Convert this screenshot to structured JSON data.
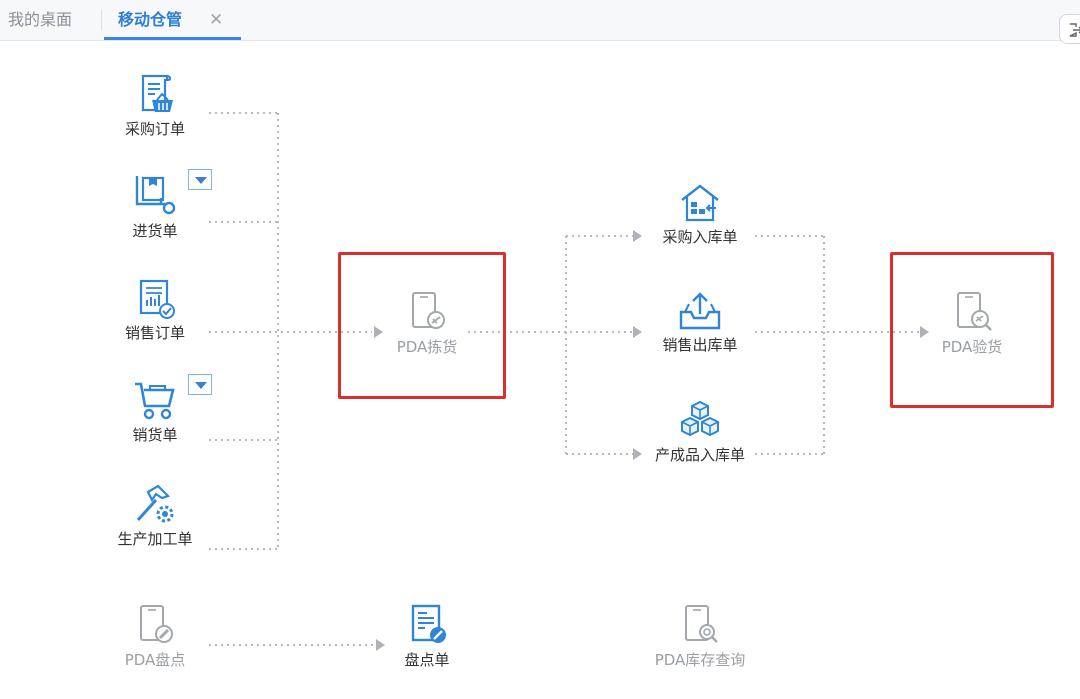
{
  "tabs": {
    "desktop": "我的桌面",
    "active": "移动仓管",
    "close": "✕"
  },
  "flow": {
    "sources": [
      {
        "label": "采购订单",
        "icon": "purchase-order-icon",
        "has_dropdown": false
      },
      {
        "label": "进货单",
        "icon": "receiving-cart-icon",
        "has_dropdown": true
      },
      {
        "label": "销售订单",
        "icon": "sales-order-icon",
        "has_dropdown": false
      },
      {
        "label": "销货单",
        "icon": "shopping-cart-icon",
        "has_dropdown": true
      },
      {
        "label": "生产加工单",
        "icon": "hammer-gear-icon",
        "has_dropdown": false
      }
    ],
    "picking": {
      "label": "PDA拣货",
      "icon": "pda-picking-icon"
    },
    "targets": [
      {
        "label": "采购入库单",
        "icon": "warehouse-in-icon"
      },
      {
        "label": "销售出库单",
        "icon": "tray-out-icon"
      },
      {
        "label": "产成品入库单",
        "icon": "boxes-icon"
      }
    ],
    "inspection": {
      "label": "PDA验货",
      "icon": "pda-inspect-icon"
    }
  },
  "bottom": {
    "stocktake": {
      "label": "PDA盘点",
      "icon": "pda-stocktake-icon"
    },
    "stocktake_sheet": {
      "label": "盘点单",
      "icon": "stocktake-sheet-icon"
    },
    "inventory_query": {
      "label": "PDA库存查询",
      "icon": "pda-search-icon"
    }
  },
  "colors": {
    "accent": "#3a86de",
    "icon_blue": "#2f86d6",
    "highlight": "#d9302c",
    "disabled": "#9a9ea4",
    "connector": "#b9b9c2"
  }
}
